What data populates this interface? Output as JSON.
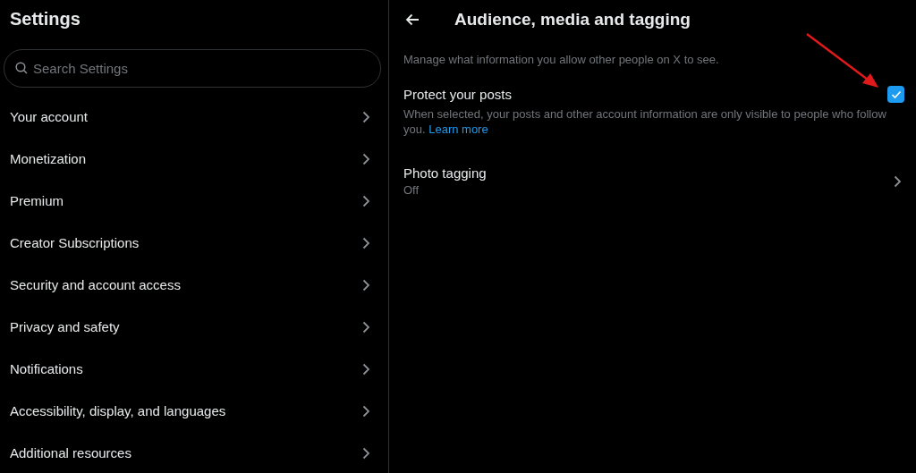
{
  "sidebar": {
    "title": "Settings",
    "search": {
      "placeholder": "Search Settings"
    },
    "items": [
      {
        "label": "Your account"
      },
      {
        "label": "Monetization"
      },
      {
        "label": "Premium"
      },
      {
        "label": "Creator Subscriptions"
      },
      {
        "label": "Security and account access"
      },
      {
        "label": "Privacy and safety"
      },
      {
        "label": "Notifications"
      },
      {
        "label": "Accessibility, display, and languages"
      },
      {
        "label": "Additional resources"
      }
    ]
  },
  "main": {
    "title": "Audience, media and tagging",
    "description": "Manage what information you allow other people on X to see.",
    "settings": [
      {
        "kind": "checkbox",
        "label": "Protect your posts",
        "checked": true,
        "description": "When selected, your posts and other account information are only visible to people who follow you.",
        "link": "Learn more"
      },
      {
        "kind": "link",
        "label": "Photo tagging",
        "value": "Off"
      }
    ]
  }
}
